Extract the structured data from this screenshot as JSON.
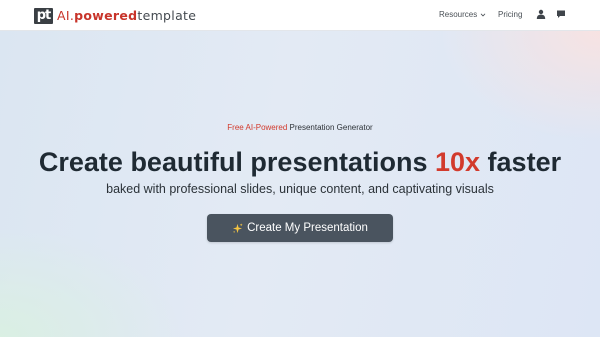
{
  "brand": {
    "mark": "pt",
    "name_prefix": "AI.",
    "name_bold": "powered",
    "name_suffix": "template"
  },
  "nav": {
    "resources_label": "Resources",
    "pricing_label": "Pricing",
    "user_icon": "user-icon",
    "chat_icon": "chat-icon"
  },
  "hero": {
    "eyebrow_accent": "Free AI-Powered",
    "eyebrow_rest": " Presentation Generator",
    "headline_before": "Create beautiful presentations ",
    "headline_highlight": "10x",
    "headline_after": " faster",
    "subheadline": "baked with professional slides, unique content, and captivating visuals",
    "cta_label": "Create My Presentation",
    "cta_icon": "sparkles-icon"
  },
  "colors": {
    "brand_red": "#d23a2c",
    "cta_background": "#4a545f",
    "heading": "#1f2a33"
  }
}
